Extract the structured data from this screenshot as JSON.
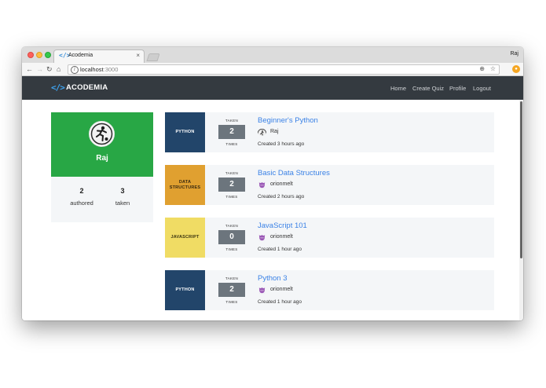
{
  "browser": {
    "tab_title": "Acodemia",
    "tab_icon": "</>",
    "tab_close": "×",
    "profile_name": "Raj",
    "url_host": "localhost",
    "url_port": ":3000"
  },
  "navbar": {
    "brand_icon": "</>",
    "brand": "ACODEMIA",
    "links": [
      "Home",
      "Create Quiz",
      "Profile",
      "Logout"
    ]
  },
  "profile": {
    "username": "Raj",
    "authored_count": "2",
    "authored_label": "authored",
    "taken_count": "3",
    "taken_label": "taken"
  },
  "quizzes": [
    {
      "tag": "PYTHON",
      "tag_bg": "#22456a",
      "tag_color": "#ffffff",
      "taken_label": "TAKEN",
      "count": "2",
      "times_label": "TIMES",
      "title": "Beginner's Python",
      "author": "Raj",
      "author_avatar": "soccer",
      "created": "Created 3 hours ago"
    },
    {
      "tag": "DATA STRUCTURES",
      "tag_bg": "#e0a030",
      "tag_color": "#3a2a10",
      "taken_label": "TAKEN",
      "count": "2",
      "times_label": "TIMES",
      "title": "Basic Data Structures",
      "author": "orionmelt",
      "author_avatar": "purple",
      "created": "Created 2 hours ago"
    },
    {
      "tag": "JAVASCRIPT",
      "tag_bg": "#f0dc64",
      "tag_color": "#3a3410",
      "taken_label": "TAKEN",
      "count": "0",
      "times_label": "TIMES",
      "title": "JavaScript 101",
      "author": "orionmelt",
      "author_avatar": "purple",
      "created": "Created 1 hour ago"
    },
    {
      "tag": "PYTHON",
      "tag_bg": "#22456a",
      "tag_color": "#ffffff",
      "taken_label": "TAKEN",
      "count": "2",
      "times_label": "TIMES",
      "title": "Python 3",
      "author": "orionmelt",
      "author_avatar": "purple",
      "created": "Created 1 hour ago"
    }
  ],
  "colors": {
    "navbar_bg": "#343a40",
    "profile_header_bg": "#28a745",
    "link_blue": "#3b82e6",
    "count_box_bg": "#6c757d"
  }
}
